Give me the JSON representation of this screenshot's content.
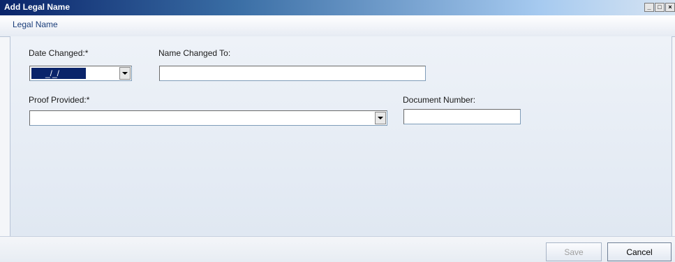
{
  "window": {
    "title": "Add Legal Name",
    "controls": {
      "minimize": "_",
      "maximize": "□",
      "close": "×"
    }
  },
  "group": {
    "title": "Legal Name"
  },
  "form": {
    "date_changed": {
      "label": "Date Changed:*",
      "value": "_/_/"
    },
    "name_changed_to": {
      "label": "Name Changed To:",
      "value": ""
    },
    "proof_provided": {
      "label": "Proof Provided:*",
      "value": ""
    },
    "document_number": {
      "label": "Document Number:",
      "value": ""
    }
  },
  "buttons": {
    "save": {
      "label": "Save",
      "enabled": false
    },
    "cancel": {
      "label": "Cancel",
      "enabled": true
    }
  },
  "colors": {
    "titlebar_start": "#0a246a",
    "selection": "#0a246a",
    "panel": "#e8eef6"
  }
}
